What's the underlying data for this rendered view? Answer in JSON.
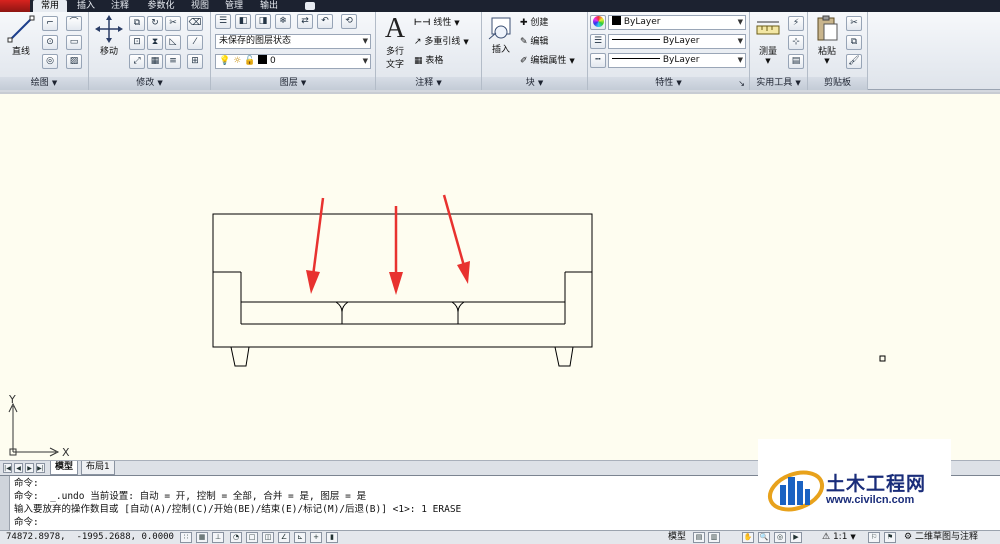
{
  "tabs": [
    "常用",
    "插入",
    "注释",
    "参数化",
    "视图",
    "管理",
    "输出"
  ],
  "ribbon": {
    "draw": {
      "footer": "绘图",
      "line_label": "直线"
    },
    "modify": {
      "footer": "修改",
      "move_label": "移动"
    },
    "layers": {
      "footer": "图层",
      "layer_state": "未保存的图层状态",
      "current_layer": "0",
      "layer_color": "#000000"
    },
    "annotation": {
      "footer": "注释",
      "mtext_label_1": "多行",
      "mtext_label_2": "文字",
      "linear": "线性",
      "mleader": "多重引线",
      "table": "表格"
    },
    "block": {
      "footer": "块",
      "insert": "插入",
      "create": "创建",
      "edit": "编辑",
      "edit_attr": "编辑属性"
    },
    "properties": {
      "footer": "特性",
      "color": "ByLayer",
      "linetype": "ByLayer",
      "lineweight": "ByLayer"
    },
    "utilities": {
      "footer": "实用工具",
      "measure": "测量"
    },
    "clipboard": {
      "footer": "剪贴板",
      "paste": "粘贴"
    }
  },
  "drawing": {
    "ucs_x": "X",
    "ucs_y": "Y",
    "arrow_color": "#e8322f",
    "background": "#fefdf0"
  },
  "layout_tabs": [
    "模型",
    "布局1"
  ],
  "command": {
    "lines": [
      "命令:",
      "命令:  _.undo 当前设置: 自动 = 开, 控制 = 全部, 合并 = 是, 图层 = 是",
      "输入要放弃的操作数目或 [自动(A)/控制(C)/开始(BE)/结束(E)/标记(M)/后退(B)] <1>: 1 ERASE",
      "命令:"
    ]
  },
  "status": {
    "coords": "74872.8978,  -1995.2688, 0.0000",
    "model": "模型",
    "scale": "1:1",
    "workspace": "二维草图与注释"
  },
  "watermark": {
    "title": "土木工程网",
    "url": "www.civilcn.com"
  }
}
